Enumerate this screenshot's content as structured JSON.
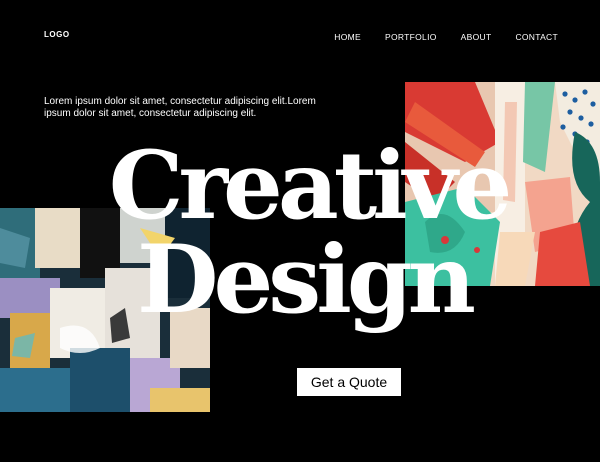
{
  "header": {
    "logo": "LOGO",
    "nav": [
      "HOME",
      "PORTFOLIO",
      "ABOUT",
      "CONTACT"
    ]
  },
  "intro": {
    "text": "Lorem ipsum dolor sit amet, consectetur adipiscing elit.Lorem ipsum dolor sit amet, consectetur adipiscing elit."
  },
  "hero": {
    "line1": "Creative",
    "line2": "Design"
  },
  "cta": {
    "label": "Get a Quote"
  },
  "colors": {
    "background": "#000000",
    "text": "#ffffff",
    "button_bg": "#ffffff",
    "button_text": "#000000"
  }
}
